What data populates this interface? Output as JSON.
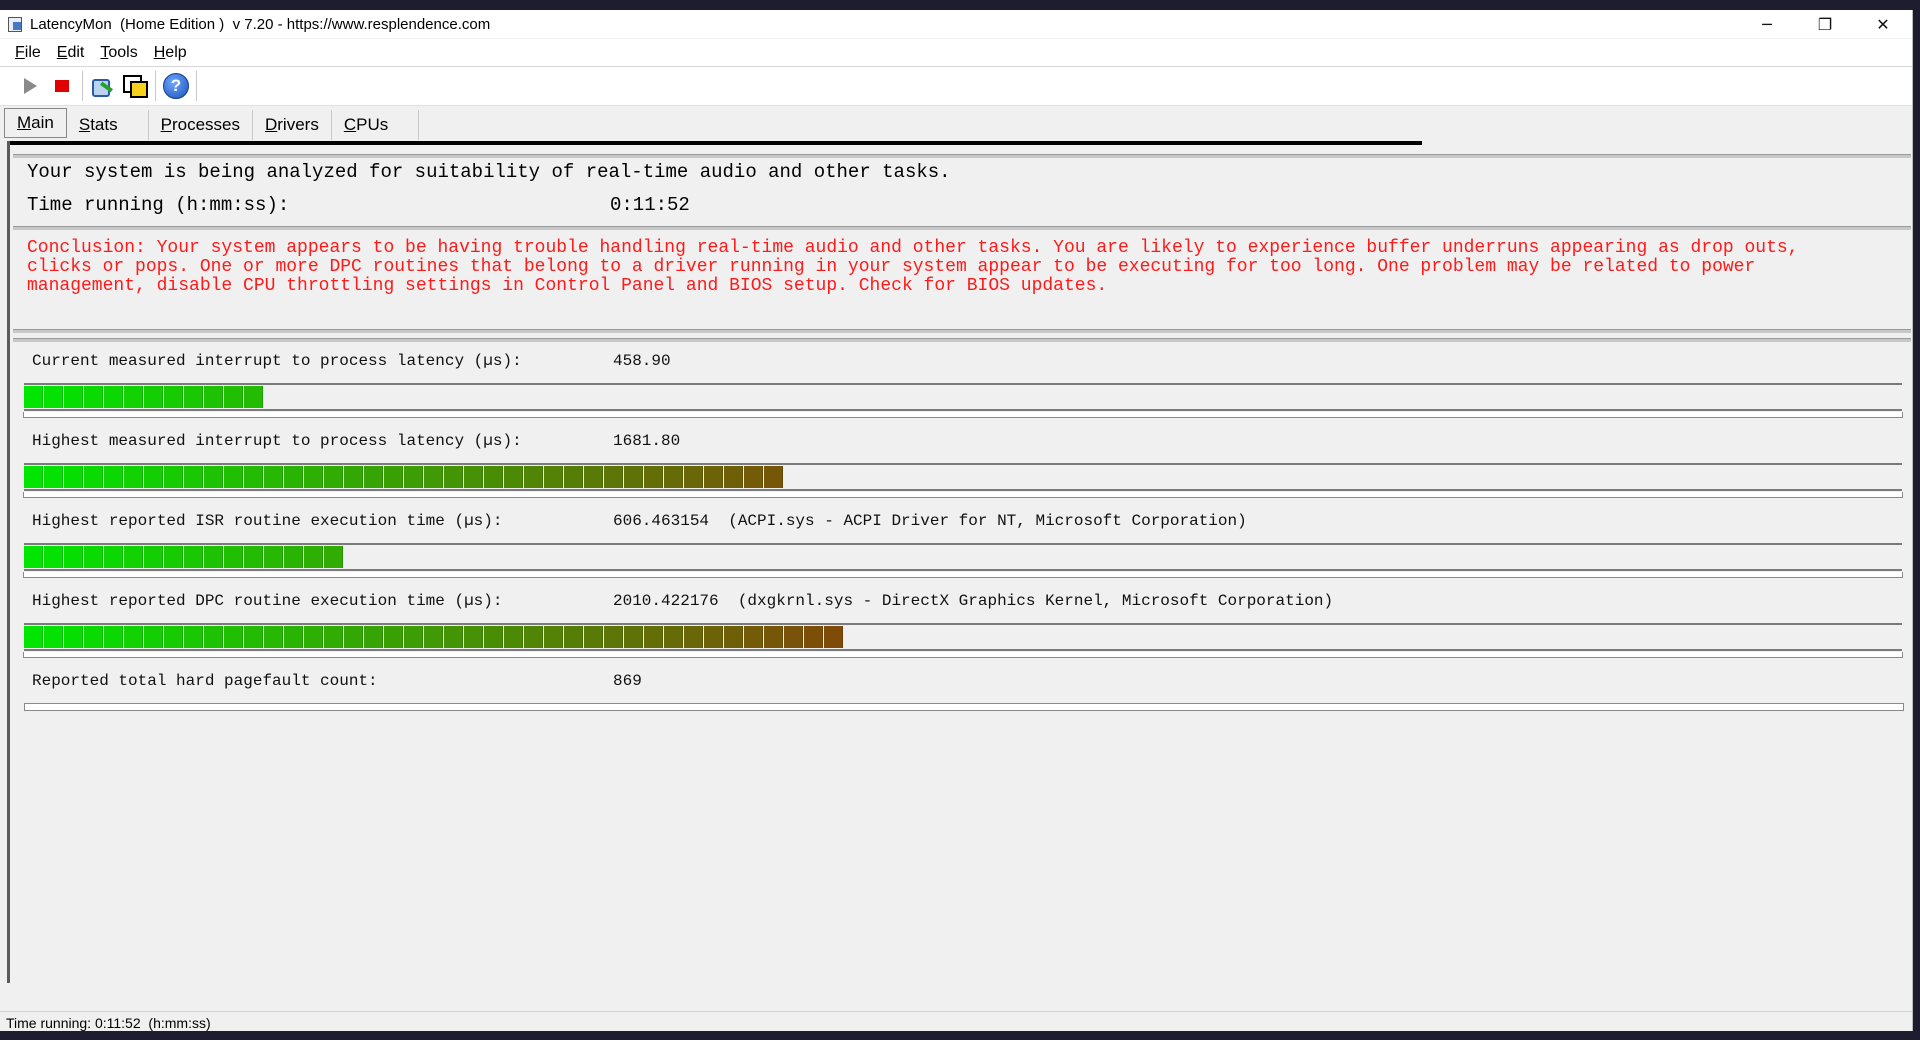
{
  "window": {
    "title": "LatencyMon  (Home Edition )  v 7.20 - https://www.resplendence.com",
    "minimize": "─",
    "restore": "❐",
    "close": "✕"
  },
  "menu": {
    "file": {
      "u": "F",
      "rest": "ile"
    },
    "edit": {
      "u": "E",
      "rest": "dit"
    },
    "tools": {
      "u": "T",
      "rest": "ools"
    },
    "help": {
      "u": "H",
      "rest": "elp"
    }
  },
  "toolbar": {
    "icons": [
      "play-icon",
      "stop-icon",
      "tools-icon",
      "windows-icon",
      "help-icon"
    ],
    "help_glyph": "?"
  },
  "tabs": [
    {
      "u": "M",
      "rest": "ain",
      "active": true
    },
    {
      "u": "S",
      "rest": "tats"
    },
    {
      "u": "P",
      "rest": "rocesses"
    },
    {
      "u": "D",
      "rest": "rivers"
    },
    {
      "u": "C",
      "rest": "PUs"
    }
  ],
  "main": {
    "analysis_text": "Your system is being analyzed for suitability of real-time audio and other tasks.",
    "time_running_label": "Time running (h:mm:ss):",
    "time_running_value": "0:11:52",
    "conclusion_line1": "Conclusion: Your system appears to be having trouble handling real-time audio and other tasks. You are likely to experience buffer underruns appearing as drop outs,",
    "conclusion_line2": "clicks or pops. One or more DPC routines that belong to a driver running in your system appear to be executing for too long. One problem may be related to power",
    "conclusion_line3": "management, disable CPU throttling settings in Control Panel and BIOS setup. Check for BIOS updates.",
    "metrics": [
      {
        "label": "Current measured interrupt to process latency (µs):",
        "value": "458.90",
        "segments": 12
      },
      {
        "label": "Highest measured interrupt to process latency (µs):",
        "value": "1681.80",
        "segments": 38
      },
      {
        "label": "Highest reported ISR routine execution time (µs):",
        "value": "606.463154  (ACPI.sys - ACPI Driver for NT, Microsoft Corporation)",
        "segments": 16
      },
      {
        "label": "Highest reported DPC routine execution time (µs):",
        "value": "2010.422176  (dxgkrnl.sys - DirectX Graphics Kernel, Microsoft Corporation)",
        "segments": 41
      },
      {
        "label": "Reported total hard pagefault count:",
        "value": "869",
        "segments": 0
      }
    ]
  },
  "statusbar": {
    "text": "Time running: 0:11:52  (h:mm:ss)"
  }
}
